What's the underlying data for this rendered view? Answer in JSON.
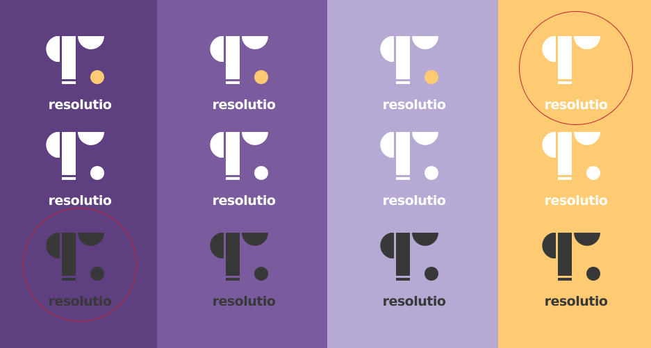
{
  "brand": {
    "wordmark": "resolutio"
  },
  "colors": {
    "deep_purple": "#5e4080",
    "mid_purple": "#7a5c9e",
    "lavender": "#b6a9d4",
    "amber": "#fecb72",
    "logo_white": "#ffffff",
    "logo_dark": "#383838",
    "dot_amber": "#fecb72",
    "highlight_ring": "#c0202f"
  },
  "columns": [
    {
      "background": "#5e4080",
      "variants": [
        {
          "mark": "#ffffff",
          "dot": "#fecb72",
          "text": "#ffffff",
          "highlighted": false
        },
        {
          "mark": "#ffffff",
          "dot": "#ffffff",
          "text": "#ffffff",
          "highlighted": false
        },
        {
          "mark": "#383838",
          "dot": "#383838",
          "text": "#383838",
          "highlighted": true
        }
      ]
    },
    {
      "background": "#7a5c9e",
      "variants": [
        {
          "mark": "#ffffff",
          "dot": "#fecb72",
          "text": "#ffffff",
          "highlighted": false
        },
        {
          "mark": "#ffffff",
          "dot": "#ffffff",
          "text": "#ffffff",
          "highlighted": false
        },
        {
          "mark": "#383838",
          "dot": "#383838",
          "text": "#383838",
          "highlighted": false
        }
      ]
    },
    {
      "background": "#b6a9d4",
      "variants": [
        {
          "mark": "#ffffff",
          "dot": "#fecb72",
          "text": "#ffffff",
          "highlighted": false
        },
        {
          "mark": "#ffffff",
          "dot": "#ffffff",
          "text": "#ffffff",
          "highlighted": false
        },
        {
          "mark": "#383838",
          "dot": "#383838",
          "text": "#383838",
          "highlighted": false
        }
      ]
    },
    {
      "background": "#fecb72",
      "variants": [
        {
          "mark": "#ffffff",
          "dot": "#fecb72",
          "text": "#ffffff",
          "highlighted": true
        },
        {
          "mark": "#ffffff",
          "dot": "#ffffff",
          "text": "#ffffff",
          "highlighted": false
        },
        {
          "mark": "#383838",
          "dot": "#383838",
          "text": "#383838",
          "highlighted": false
        }
      ]
    }
  ]
}
